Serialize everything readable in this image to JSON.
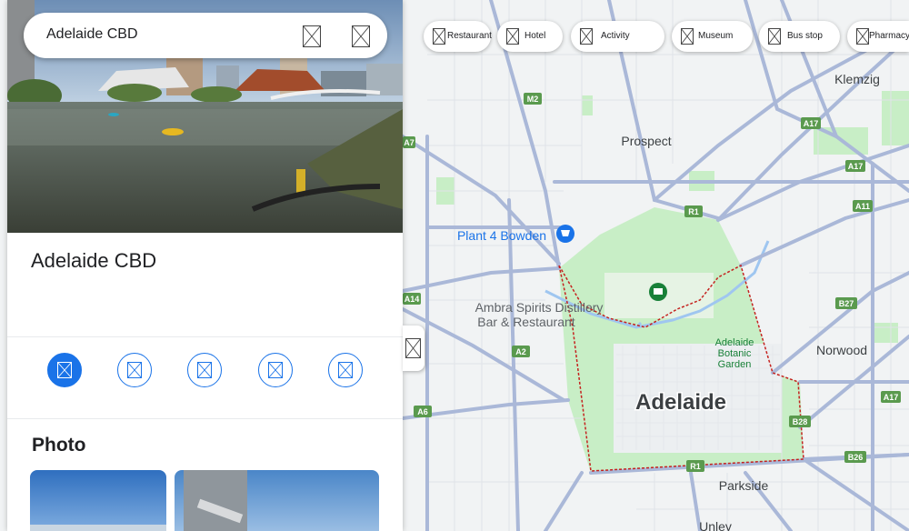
{
  "search": {
    "query": "Adelaide CBD"
  },
  "place": {
    "title": "Adelaide CBD"
  },
  "actions": [
    {
      "icon": "directions-icon",
      "primary": true
    },
    {
      "icon": "save-icon",
      "primary": false
    },
    {
      "icon": "nearby-icon",
      "primary": false
    },
    {
      "icon": "send-to-phone-icon",
      "primary": false
    },
    {
      "icon": "share-icon",
      "primary": false
    }
  ],
  "photos": {
    "heading": "Photo"
  },
  "chips": [
    {
      "label": "Restaurant",
      "icon": "restaurant-icon"
    },
    {
      "label": "Hotel",
      "icon": "hotel-icon"
    },
    {
      "label": "Activity",
      "icon": "activity-icon"
    },
    {
      "label": "Museum",
      "icon": "museum-icon"
    },
    {
      "label": "Bus stop",
      "icon": "bus-stop-icon"
    },
    {
      "label": "Pharmacy",
      "icon": "pharmacy-icon"
    }
  ],
  "map": {
    "labels": {
      "klemzig": "Klemzig",
      "prospect": "Prospect",
      "plant4": "Plant 4 Bowden",
      "ambra1": "Ambra Spirits Distillery",
      "ambra2": "Bar & Restaurant",
      "botanic1": "Adelaide",
      "botanic2": "Botanic",
      "botanic3": "Garden",
      "adelaide": "Adelaide",
      "norwood": "Norwood",
      "parkside": "Parkside",
      "unley": "Unley"
    },
    "shields": {
      "m2": "M2",
      "a7": "A7",
      "a17a": "A17",
      "a17b": "A17",
      "a17c": "A17",
      "a11": "A11",
      "r1a": "R1",
      "r1b": "R1",
      "a14": "A14",
      "b27": "B27",
      "a2": "A2",
      "a6": "A6",
      "b28": "B28",
      "b26": "B26"
    },
    "colors": {
      "land": "#f1f3f4",
      "park": "#c8eec6",
      "road": "#aab8d8",
      "road_edge": "#8e9fc8",
      "poi_blue": "#1a73e8",
      "poi_green": "#188038",
      "boundary": "#c5221f",
      "shield": "#5a9a4e"
    }
  }
}
